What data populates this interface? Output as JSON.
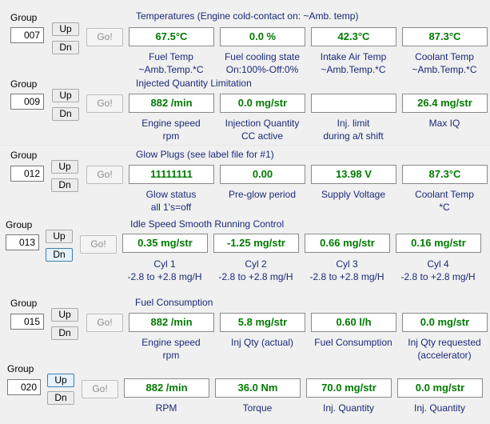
{
  "groups": [
    {
      "group_label": "Group",
      "number": "007",
      "up": "Up",
      "dn": "Dn",
      "go": "Go!",
      "title": "Temperatures (Engine cold-contact on: ~Amb. temp)",
      "fields": [
        {
          "value": "67.5°C",
          "label1": "Fuel Temp",
          "label2": "~Amb.Temp.*C"
        },
        {
          "value": "0.0 %",
          "label1": "Fuel cooling state",
          "label2": "On:100%-Off:0%"
        },
        {
          "value": "42.3°C",
          "label1": "Intake Air Temp",
          "label2": "~Amb.Temp.*C"
        },
        {
          "value": "87.3°C",
          "label1": "Coolant Temp",
          "label2": "~Amb.Temp.*C"
        }
      ]
    },
    {
      "group_label": "Group",
      "number": "009",
      "up": "Up",
      "dn": "Dn",
      "go": "Go!",
      "title": "Injected Quantity Limitation",
      "fields": [
        {
          "value": "882 /min",
          "label1": "Engine speed",
          "label2": "rpm"
        },
        {
          "value": "0.0 mg/str",
          "label1": "Injection Quantity",
          "label2": "CC active"
        },
        {
          "value": "",
          "label1": "Inj. limit",
          "label2": "during a/t shift"
        },
        {
          "value": "26.4 mg/str",
          "label1": "Max IQ",
          "label2": ""
        }
      ]
    },
    {
      "group_label": "Group",
      "number": "012",
      "up": "Up",
      "dn": "Dn",
      "go": "Go!",
      "title": "Glow Plugs (see label file for #1)",
      "fields": [
        {
          "value": "11111111",
          "label1": "Glow status",
          "label2": "all 1's=off"
        },
        {
          "value": "0.00",
          "label1": "Pre-glow period",
          "label2": ""
        },
        {
          "value": "13.98 V",
          "label1": "Supply Voltage",
          "label2": ""
        },
        {
          "value": "87.3°C",
          "label1": "Coolant Temp",
          "label2": "*C"
        }
      ]
    },
    {
      "group_label": "Group",
      "number": "013",
      "up": "Up",
      "dn": "Dn",
      "go": "Go!",
      "title": "Idle Speed Smooth Running Control",
      "fields": [
        {
          "value": "0.35 mg/str",
          "label1": "Cyl 1",
          "label2": "-2.8 to +2.8 mg/H"
        },
        {
          "value": "-1.25 mg/str",
          "label1": "Cyl 2",
          "label2": "-2.8 to +2.8 mg/H"
        },
        {
          "value": "0.66 mg/str",
          "label1": "Cyl 3",
          "label2": "-2.8 to +2.8 mg/H"
        },
        {
          "value": "0.16 mg/str",
          "label1": "Cyl 4",
          "label2": "-2.8 to +2.8 mg/H"
        }
      ]
    },
    {
      "group_label": "Group",
      "number": "015",
      "up": "Up",
      "dn": "Dn",
      "go": "Go!",
      "title": "Fuel Consumption",
      "fields": [
        {
          "value": "882 /min",
          "label1": "Engine speed",
          "label2": "rpm"
        },
        {
          "value": "5.8 mg/str",
          "label1": "Inj Qty (actual)",
          "label2": ""
        },
        {
          "value": "0.60 l/h",
          "label1": "Fuel Consumption",
          "label2": ""
        },
        {
          "value": "0.0 mg/str",
          "label1": "Inj Qty requested",
          "label2": "(accelerator)"
        }
      ]
    },
    {
      "group_label": "Group",
      "number": "020",
      "up": "Up",
      "dn": "Dn",
      "go": "Go!",
      "title": "",
      "fields": [
        {
          "value": "882 /min",
          "label1": "RPM",
          "label2": ""
        },
        {
          "value": "36.0 Nm",
          "label1": "Torque",
          "label2": ""
        },
        {
          "value": "70.0 mg/str",
          "label1": "Inj. Quantity",
          "label2": ""
        },
        {
          "value": "0.0 mg/str",
          "label1": "Inj. Quantity",
          "label2": ""
        }
      ]
    }
  ],
  "colors": {
    "value_text": "#007a00",
    "label_text": "#1a2a7a"
  }
}
